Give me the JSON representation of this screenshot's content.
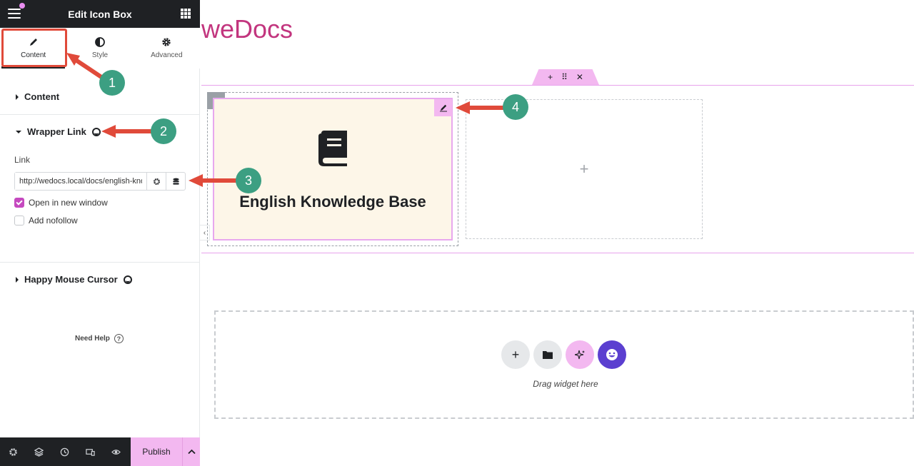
{
  "panel": {
    "title": "Edit Icon Box",
    "tabs": [
      {
        "label": "Content",
        "icon": "pencil-icon"
      },
      {
        "label": "Style",
        "icon": "half-circle-icon"
      },
      {
        "label": "Advanced",
        "icon": "gear-icon"
      }
    ],
    "sections": {
      "content": "Content",
      "wrapper_link": "Wrapper Link",
      "happy_mouse_cursor": "Happy Mouse Cursor"
    },
    "link_label": "Link",
    "link_value": "http://wedocs.local/docs/english-knowledge-base/",
    "options": {
      "open_new_window": {
        "label": "Open in new window",
        "checked": true
      },
      "add_nofollow": {
        "label": "Add nofollow",
        "checked": false
      }
    },
    "need_help": "Need Help",
    "footer": {
      "publish": "Publish"
    }
  },
  "canvas": {
    "brand": "weDocs",
    "widget_title": "English Knowledge Base",
    "drop_text": "Drag widget here"
  },
  "annotations": {
    "badges": [
      "1",
      "2",
      "3",
      "4"
    ],
    "arrow_color": "#e04a3a",
    "badge_color": "#3c9f82"
  },
  "colors": {
    "accent": "#f3b8f0",
    "brand": "#c2357e",
    "checkbox": "#c549bf",
    "header": "#1f2124"
  }
}
